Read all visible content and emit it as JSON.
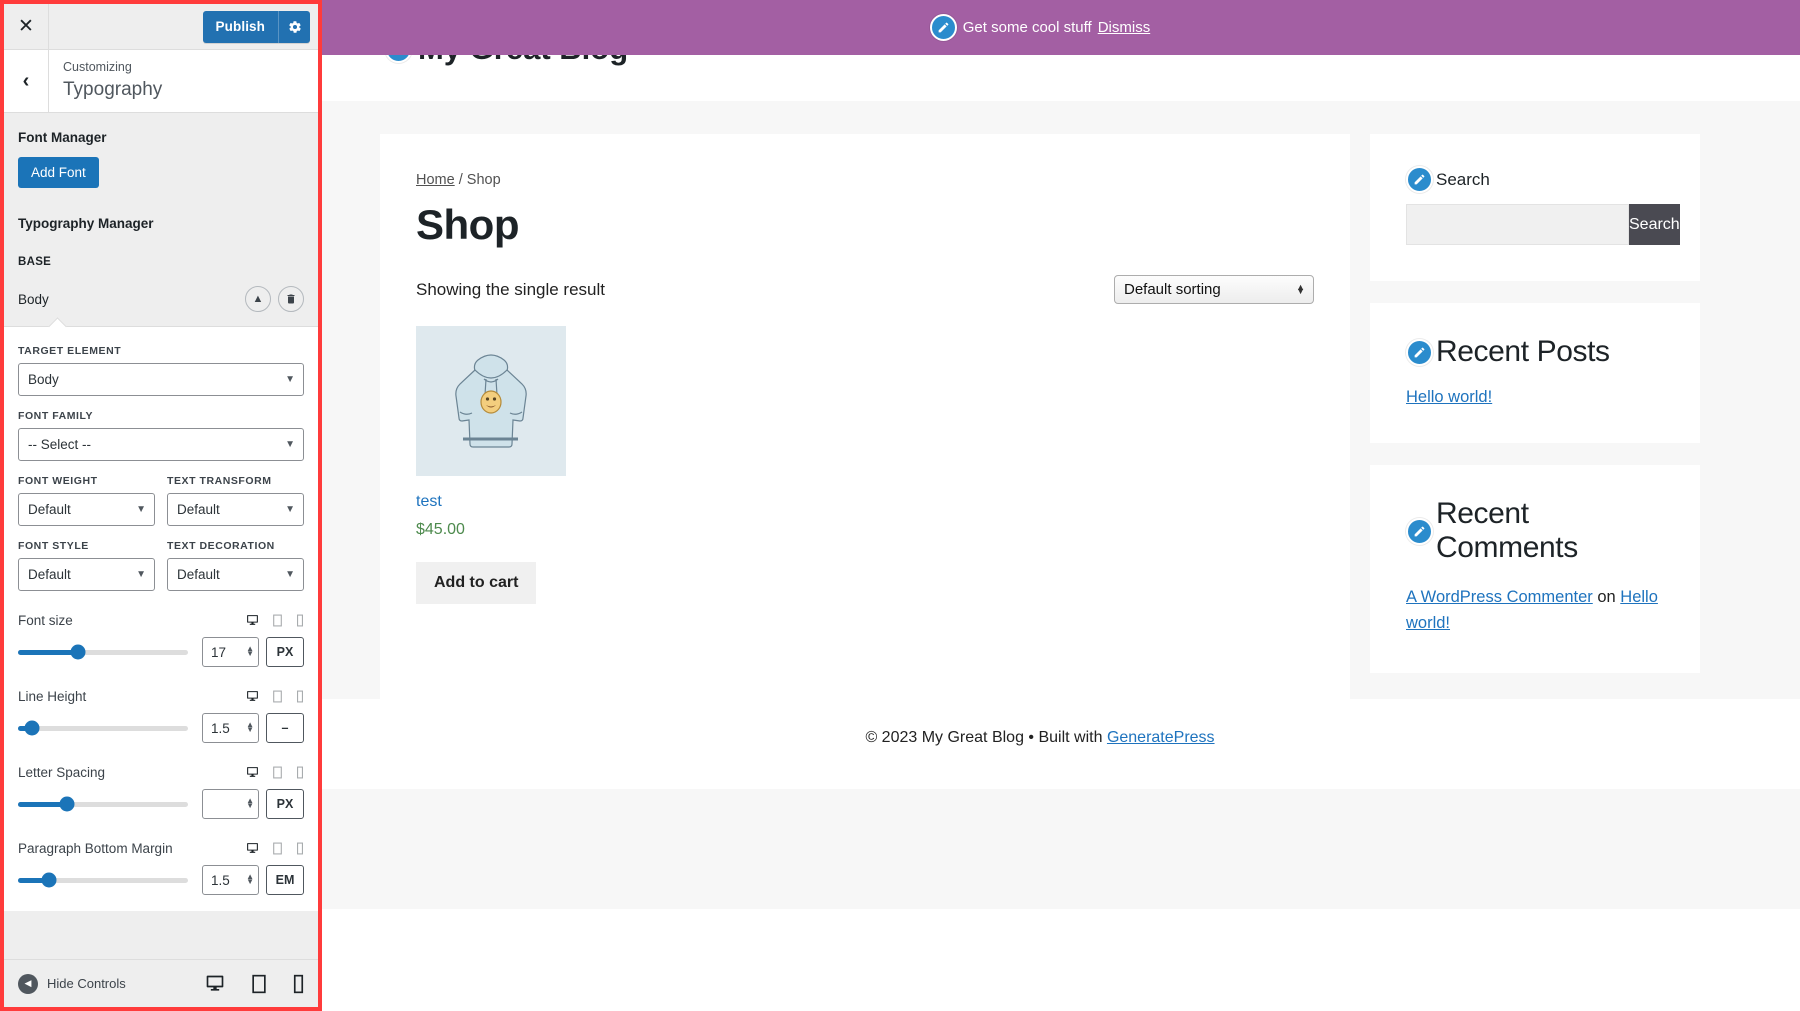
{
  "customizer": {
    "close_icon": "close-icon",
    "publish_label": "Publish",
    "gear_icon": "gear-icon",
    "back_icon": "chevron-left-icon",
    "breadcrumb": "Customizing",
    "panel_title": "Typography",
    "font_manager_heading": "Font Manager",
    "add_font_label": "Add Font",
    "typography_manager_heading": "Typography Manager",
    "base_label": "BASE",
    "body_item_label": "Body",
    "collapse_icon": "chevron-up-icon",
    "delete_icon": "trash-icon",
    "fields": {
      "target_element_label": "TARGET ELEMENT",
      "target_element_value": "Body",
      "font_family_label": "FONT FAMILY",
      "font_family_value": "-- Select --",
      "font_weight_label": "FONT WEIGHT",
      "font_weight_value": "Default",
      "text_transform_label": "TEXT TRANSFORM",
      "text_transform_value": "Default",
      "font_style_label": "FONT STYLE",
      "font_style_value": "Default",
      "text_decoration_label": "TEXT DECORATION",
      "text_decoration_value": "Default"
    },
    "sliders": [
      {
        "label": "Font size",
        "value": "17",
        "unit": "PX",
        "fill_pct": 35
      },
      {
        "label": "Line Height",
        "value": "1.5",
        "unit": "–",
        "fill_pct": 8
      },
      {
        "label": "Letter Spacing",
        "value": "",
        "unit": "PX",
        "fill_pct": 29
      },
      {
        "label": "Paragraph Bottom Margin",
        "value": "1.5",
        "unit": "EM",
        "fill_pct": 18
      }
    ],
    "device_icons": [
      "desktop-icon",
      "tablet-icon",
      "mobile-icon"
    ],
    "footer": {
      "hide_controls_label": "Hide Controls",
      "hide_icon": "chevron-left-circle-icon",
      "desktop_icon": "desktop-icon",
      "tablet_icon": "tablet-icon",
      "mobile_icon": "mobile-icon"
    }
  },
  "preview": {
    "admin_notice": {
      "edit_icon": "edit-pencil-icon",
      "text": "Get some cool stuff ",
      "dismiss": "Dismiss"
    },
    "site_title": "My Great Blog",
    "breadcrumb": {
      "home": "Home",
      "separator": " / ",
      "current": "Shop"
    },
    "page_title": "Shop",
    "result_count": "Showing the single result",
    "sorting_value": "Default sorting",
    "product": {
      "image_alt": "hoodie-product-image",
      "name": "test",
      "price": "$45.00",
      "add_to_cart": "Add to cart"
    },
    "widgets": [
      {
        "icon": "edit-pencil-icon",
        "title": "Search",
        "search_placeholder": "",
        "search_button": "Search"
      },
      {
        "icon": "edit-pencil-icon",
        "title": "Recent Posts",
        "links": [
          "Hello world!"
        ]
      },
      {
        "icon": "edit-pencil-icon",
        "title": "Recent Comments",
        "comment_author": "A WordPress Commenter",
        "comment_on": " on ",
        "comment_post": "Hello world!"
      }
    ],
    "footer": {
      "copy": "© 2023 My Great Blog • Built with ",
      "link": "GeneratePress"
    }
  },
  "colors": {
    "accent_blue": "#1b74b8",
    "publish_blue": "#2271b1",
    "admin_bar_purple": "#a35fa3",
    "highlight_red": "#ff3b3b",
    "link_blue": "#1e73be",
    "price_green": "#4d8a4d"
  }
}
